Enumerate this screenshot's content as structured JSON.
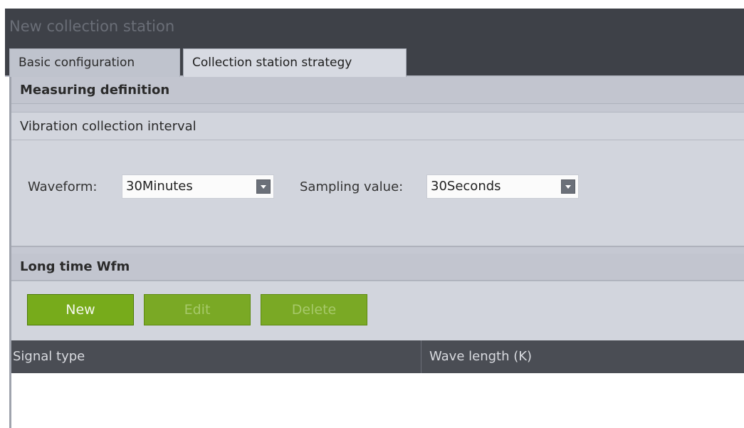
{
  "window": {
    "title": "New collection station"
  },
  "tabs": [
    {
      "label": "Basic configuration"
    },
    {
      "label": "Collection station strategy"
    }
  ],
  "measuring": {
    "title": "Measuring definition",
    "vibration_interval_label": "Vibration collection interval",
    "waveform": {
      "label": "Waveform:",
      "value": "30Minutes"
    },
    "sampling": {
      "label": "Sampling value:",
      "value": "30Seconds"
    }
  },
  "long_time": {
    "title": "Long time Wfm",
    "buttons": {
      "new": "New",
      "edit": "Edit",
      "delete": "Delete"
    }
  },
  "table": {
    "columns": [
      "Signal type",
      "Wave length (K)"
    ],
    "rows": []
  },
  "colors": {
    "title_bar": "#3e4148",
    "panel": "#c5c8d2",
    "button_green": "#77ab1b",
    "table_header": "#4a4d54"
  }
}
